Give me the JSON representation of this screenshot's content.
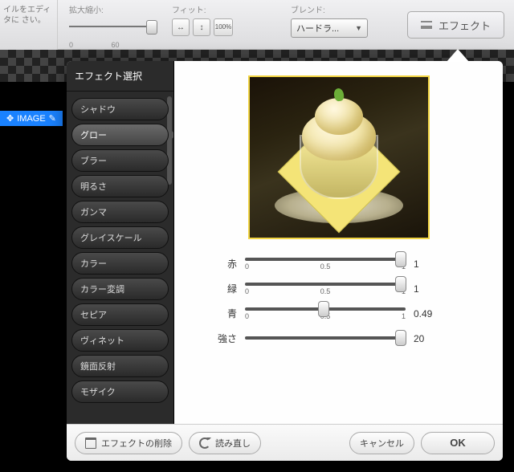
{
  "sidebar_text": "イルをエディタに\nさい。",
  "toolbar": {
    "zoom": {
      "label": "拡大縮小:",
      "tick_min": "0",
      "tick_mid": "60"
    },
    "fit": {
      "label": "フィット:",
      "btn100": "100%"
    },
    "blend": {
      "label": "ブレンド:",
      "value": "ハードラ..."
    },
    "effect_button": "エフェクト"
  },
  "image_tag": {
    "icon_label": "✥",
    "text": "IMAGE"
  },
  "dialog": {
    "title": "エフェクト選択",
    "effects": [
      "シャドウ",
      "グロー",
      "ブラー",
      "明るさ",
      "ガンマ",
      "グレイスケール",
      "カラー",
      "カラー変調",
      "セピア",
      "ヴィネット",
      "鏡面反射",
      "モザイク"
    ],
    "selected_index": 1,
    "sliders": [
      {
        "label": "赤",
        "value": "1",
        "pos": 0.97,
        "ticks": [
          "0",
          "0.5",
          "1"
        ]
      },
      {
        "label": "緑",
        "value": "1",
        "pos": 0.97,
        "ticks": [
          "0",
          "0.5",
          "1"
        ]
      },
      {
        "label": "青",
        "value": "0.49",
        "pos": 0.49,
        "ticks": [
          "0",
          "0.5",
          "1"
        ]
      },
      {
        "label": "強さ",
        "value": "20",
        "pos": 0.97,
        "ticks": [
          "",
          "",
          ""
        ]
      }
    ],
    "footer": {
      "delete": "エフェクトの削除",
      "reload": "読み直し",
      "cancel": "キャンセル",
      "ok": "OK"
    }
  }
}
